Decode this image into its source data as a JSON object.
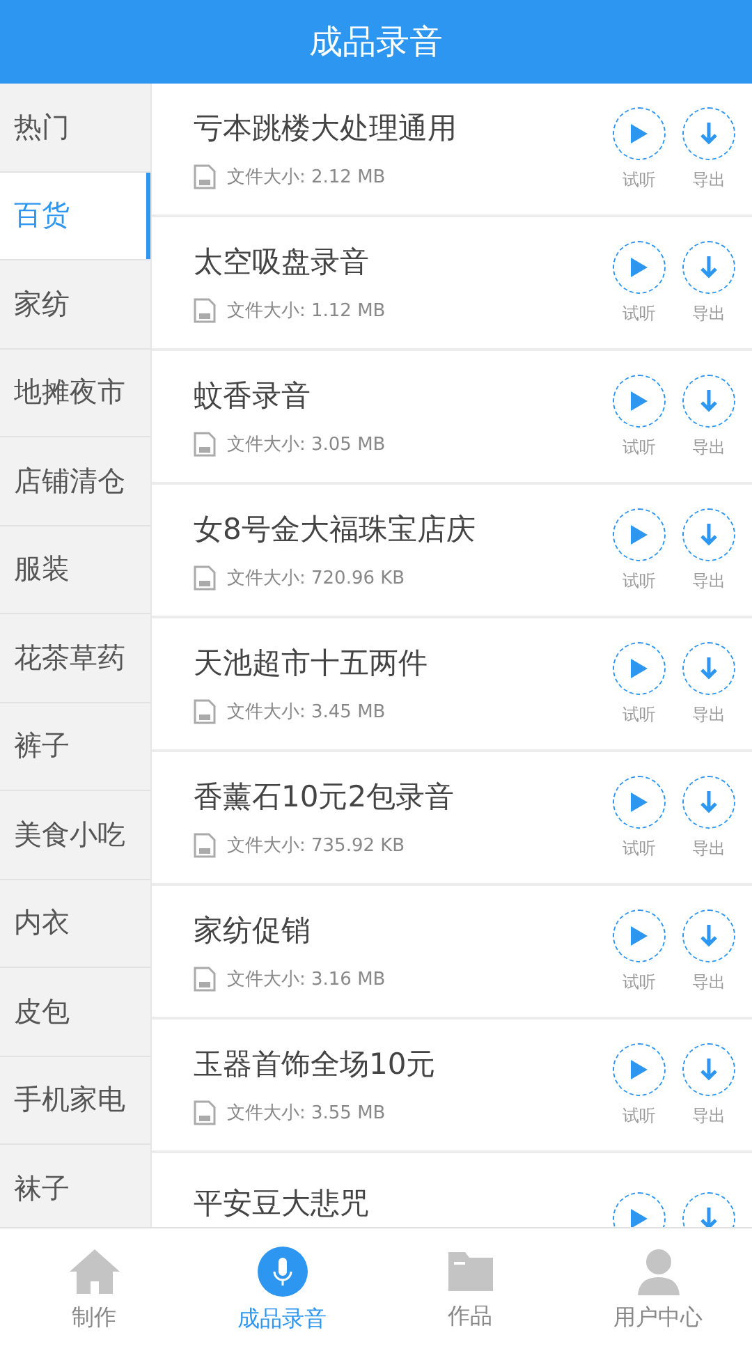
{
  "header": {
    "title": "成品录音"
  },
  "categories": [
    {
      "label": "热门",
      "selected": false
    },
    {
      "label": "百货",
      "selected": true
    },
    {
      "label": "家纺",
      "selected": false
    },
    {
      "label": "地摊夜市",
      "selected": false
    },
    {
      "label": "店铺清仓",
      "selected": false
    },
    {
      "label": "服装",
      "selected": false
    },
    {
      "label": "花茶草药",
      "selected": false
    },
    {
      "label": "裤子",
      "selected": false
    },
    {
      "label": "美食小吃",
      "selected": false
    },
    {
      "label": "内衣",
      "selected": false
    },
    {
      "label": "皮包",
      "selected": false
    },
    {
      "label": "手机家电",
      "selected": false
    },
    {
      "label": "袜子",
      "selected": false
    }
  ],
  "recordings": [
    {
      "title": "亏本跳楼大处理通用",
      "size": "文件大小: 2.12 MB",
      "play_label": "试听",
      "export_label": "导出"
    },
    {
      "title": "太空吸盘录音",
      "size": "文件大小: 1.12 MB",
      "play_label": "试听",
      "export_label": "导出"
    },
    {
      "title": "蚊香录音",
      "size": "文件大小: 3.05 MB",
      "play_label": "试听",
      "export_label": "导出"
    },
    {
      "title": "女8号金大福珠宝店庆",
      "size": "文件大小: 720.96 KB",
      "play_label": "试听",
      "export_label": "导出"
    },
    {
      "title": "天池超市十五两件",
      "size": "文件大小: 3.45 MB",
      "play_label": "试听",
      "export_label": "导出"
    },
    {
      "title": "香薰石10元2包录音",
      "size": "文件大小: 735.92 KB",
      "play_label": "试听",
      "export_label": "导出"
    },
    {
      "title": "家纺促销",
      "size": "文件大小: 3.16 MB",
      "play_label": "试听",
      "export_label": "导出"
    },
    {
      "title": "玉器首饰全场10元",
      "size": "文件大小: 3.55 MB",
      "play_label": "试听",
      "export_label": "导出"
    },
    {
      "title": "平安豆大悲咒"
    }
  ],
  "bottom_nav": [
    {
      "label": "制作",
      "kind": "home",
      "selected": false
    },
    {
      "label": "成品录音",
      "kind": "mic",
      "selected": true
    },
    {
      "label": "作品",
      "kind": "folder",
      "selected": false
    },
    {
      "label": "用户中心",
      "kind": "user",
      "selected": false
    }
  ]
}
